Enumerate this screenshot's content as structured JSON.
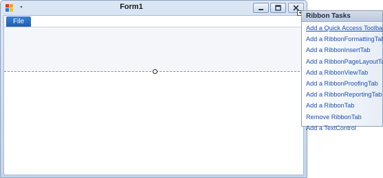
{
  "window": {
    "title": "Form1",
    "qat_dropdown_glyph": "▾"
  },
  "ribbon": {
    "file_tab_label": "File"
  },
  "ribbon_tasks": {
    "header": "Ribbon Tasks",
    "smart_tag_glyph": "◂",
    "items": [
      {
        "label": "Add a Quick Access Toolbar"
      },
      {
        "label": "Add a RibbonFormattingTab"
      },
      {
        "label": "Add a RibbonInsertTab"
      },
      {
        "label": "Add a RibbonPageLayoutTab"
      },
      {
        "label": "Add a RibbonViewTab"
      },
      {
        "label": "Add a RibbonProofingTab"
      },
      {
        "label": "Add a RibbonReportingTab"
      },
      {
        "label": "Add a RibbonTab"
      },
      {
        "label": "Remove RibbonTab"
      },
      {
        "label": "Add a TextControl"
      }
    ]
  },
  "colors": {
    "accent": "#1f5fb4",
    "link": "#1d4fb0"
  },
  "icons": [
    "app-icon",
    "dropdown-arrow-icon",
    "minimize-icon",
    "maximize-icon",
    "close-icon",
    "smart-tag-icon"
  ]
}
